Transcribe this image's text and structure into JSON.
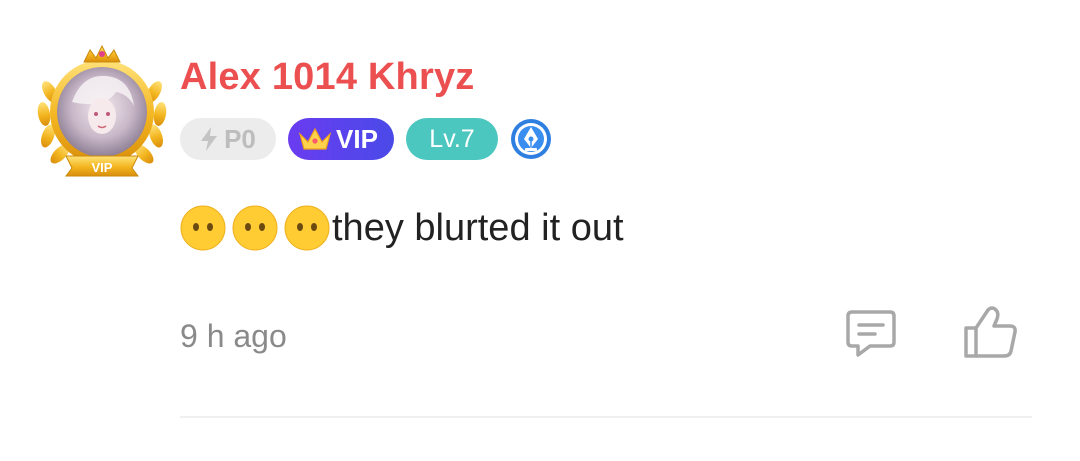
{
  "comment": {
    "username": "Alex 1014 Khryz",
    "avatar": {
      "icon": "vip-gold-laurel-frame",
      "frame_label": "VIP"
    },
    "badges": {
      "points_icon": "lightning-icon",
      "points_label": "P0",
      "vip_icon": "crown-icon",
      "vip_label": "VIP",
      "level_label": "Lv.7",
      "extra_icon": "fountain-pen-icon"
    },
    "message": {
      "emojis": [
        "neutral-no-mouth-emoji",
        "neutral-no-mouth-emoji",
        "neutral-no-mouth-emoji"
      ],
      "text": "they blurted it out"
    },
    "timestamp": "9 h ago",
    "actions": {
      "reply_icon": "comment-reply-icon",
      "like_icon": "thumbs-up-icon"
    },
    "colors": {
      "username": "#ec4f50",
      "vip_badge": "#5a43ec",
      "level_badge": "#4cc7c0",
      "points_badge": "#ececec",
      "timestamp": "#8a8a8a",
      "icon_gray": "#a8a8a8"
    }
  }
}
